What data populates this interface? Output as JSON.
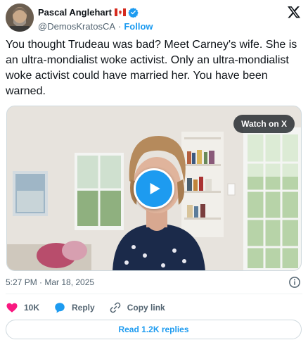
{
  "author": {
    "display_name": "Pascal Anglehart",
    "handle": "@DemosKratosCA",
    "separator": "·",
    "follow_label": "Follow"
  },
  "tweet": {
    "text": "You thought Trudeau was bad? Meet Carney's wife. She is an ultra-mondialist woke activist. Only an ultra-mondialist woke activist could have married her. You have been warned."
  },
  "media": {
    "watch_label": "Watch on X"
  },
  "meta": {
    "timestamp": "5:27 PM · Mar 18, 2025"
  },
  "actions": {
    "likes": "10K",
    "reply_label": "Reply",
    "copy_link_label": "Copy link"
  },
  "replies": {
    "label": "Read 1.2K replies"
  },
  "colors": {
    "accent": "#1d9bf0",
    "like": "#f91880",
    "text": "#0f1419",
    "muted": "#536471"
  },
  "icons": [
    "canada-flag-icon",
    "verified-badge-icon",
    "x-logo-icon",
    "play-icon",
    "info-icon",
    "heart-icon",
    "reply-bubble-icon",
    "link-icon"
  ]
}
